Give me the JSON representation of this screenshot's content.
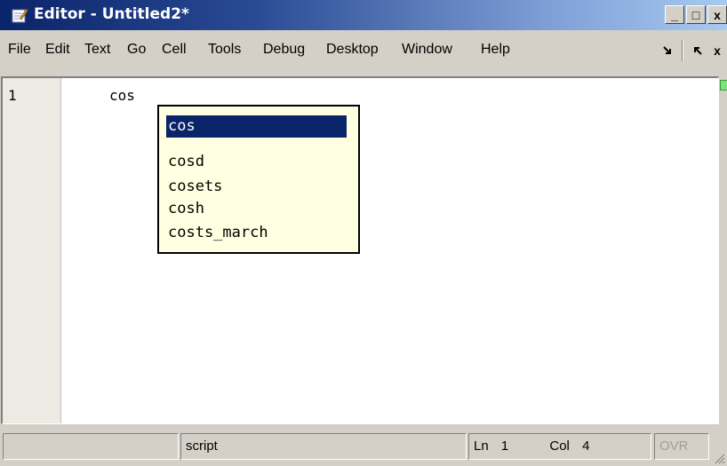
{
  "window": {
    "title": "Editor - Untitled2*",
    "controls": {
      "minimize": "_",
      "maximize": "□",
      "close": "x"
    }
  },
  "menu": {
    "items": [
      "File",
      "Edit",
      "Text",
      "Go",
      "Cell",
      "Tools",
      "Debug",
      "Desktop",
      "Window",
      "Help"
    ],
    "dock_icon": "dock-arrow-icon",
    "undock_icon": "undock-arrow-icon",
    "close_glyph": "x"
  },
  "editor": {
    "line_number": "1",
    "code": "cos"
  },
  "autocomplete": {
    "items": [
      "cos",
      "cosd",
      "cosets",
      "cosh",
      "costs_march"
    ],
    "selected": "cos",
    "colors": {
      "background": "#ffffe1",
      "selected_bg": "#0a246a"
    }
  },
  "status": {
    "mode": "script",
    "ln_label": "Ln",
    "ln_value": "1",
    "col_label": "Col",
    "col_value": "4",
    "ovr": "OVR"
  }
}
